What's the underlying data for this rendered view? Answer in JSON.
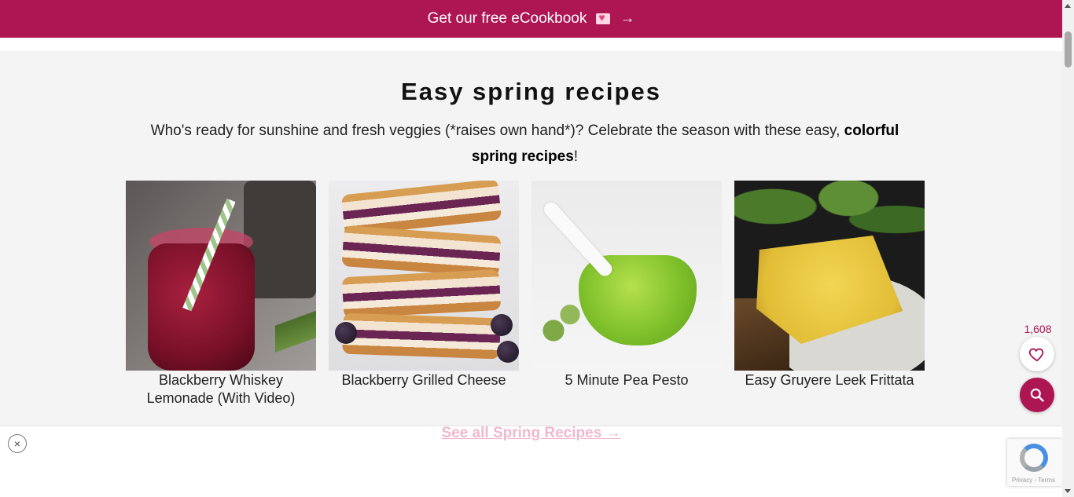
{
  "banner": {
    "text": "Get our free eCookbook",
    "arrow": "→",
    "icon": "love-letter-icon"
  },
  "section": {
    "title": "Easy spring recipes",
    "intro_text": "Who's ready for sunshine and fresh veggies (*raises own hand*)? Celebrate the season with these easy, ",
    "intro_bold": "colorful spring recipes",
    "intro_end": "!"
  },
  "recipes": [
    {
      "title": "Blackberry Whiskey Lemonade (With Video)"
    },
    {
      "title": "Blackberry Grilled Cheese"
    },
    {
      "title": "5 Minute Pea Pesto"
    },
    {
      "title": "Easy Gruyere Leek Frittata"
    }
  ],
  "see_all": "See all Spring Recipes →",
  "favorites": {
    "count": "1,608",
    "icon": "heart-icon"
  },
  "search": {
    "icon": "search-icon"
  },
  "ad": {
    "close": "×"
  },
  "recaptcha": {
    "terms": "Privacy - Terms"
  },
  "colors": {
    "brand": "#ad1553",
    "section_bg": "#f4f4f4"
  }
}
